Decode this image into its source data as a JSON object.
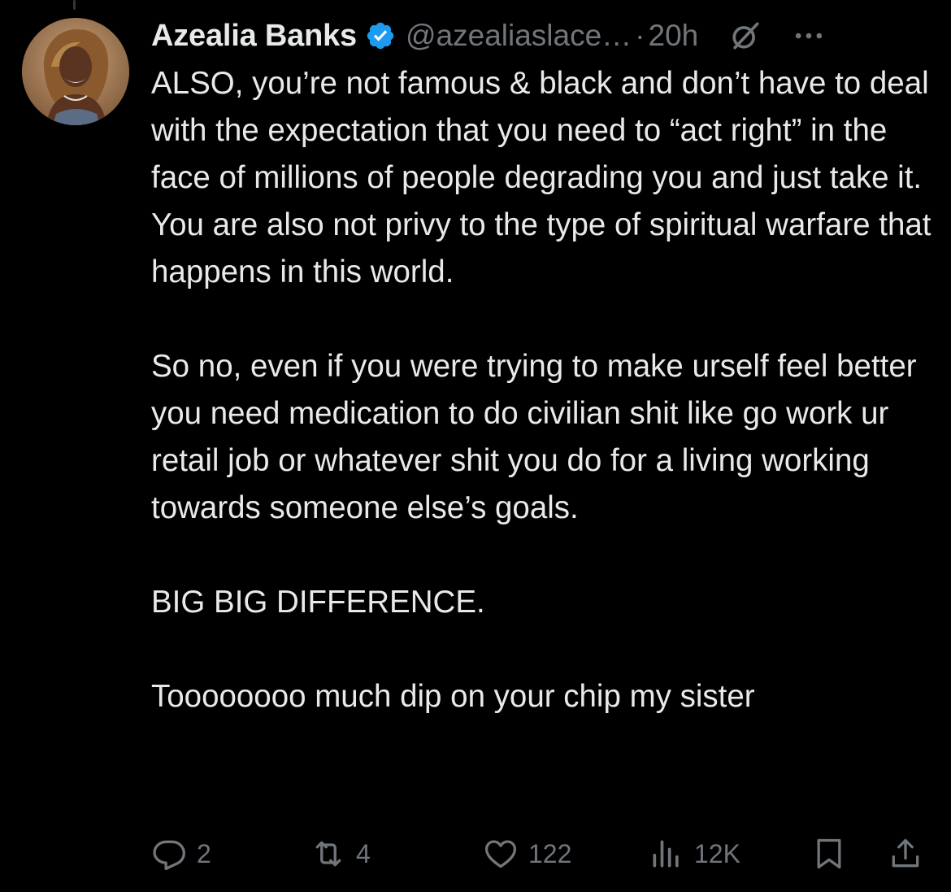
{
  "tweet": {
    "display_name": "Azealia Banks",
    "handle": "@azealiaslace…",
    "separator": "·",
    "time": "20h",
    "verified_color": "#1d9bf0",
    "paragraphs": [
      "ALSO, you’re not famous & black and don’t have to deal with the expectation that you need to “act right” in the face of millions of people degrading you and just take it. You are also not privy to the type of spiritual warfare that happens in this world.",
      "So no, even if you were trying to make urself feel better you need medication to do civilian shit like go work ur retail job or whatever shit you do for a living working towards someone else’s goals.",
      "BIG BIG DIFFERENCE.",
      "Toooooooo much dip on your chip my sister"
    ]
  },
  "actions": {
    "replies": "2",
    "reposts": "4",
    "likes": "122",
    "views": "12K"
  },
  "icons": {
    "header": [
      "verified-badge-icon",
      "grok-icon",
      "more-options-icon"
    ],
    "actions": [
      "reply-icon",
      "repost-icon",
      "like-icon",
      "views-icon",
      "bookmark-icon",
      "share-icon"
    ]
  },
  "colors": {
    "background": "#000000",
    "text": "#e7e9ea",
    "secondary": "#71767b"
  }
}
